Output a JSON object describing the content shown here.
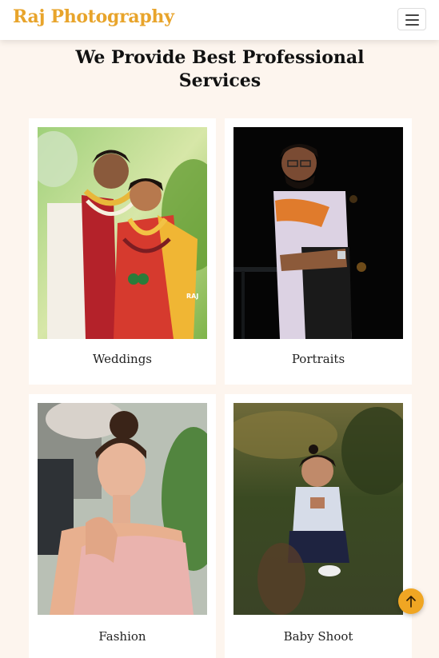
{
  "navbar": {
    "brand": "Raj Photography",
    "toggler_icon": "hamburger-icon",
    "brand_color": "#e8a42b"
  },
  "services": {
    "heading": "We Provide Best Professional Services",
    "items": [
      {
        "label": "Weddings",
        "image": "wedding-couple-photo"
      },
      {
        "label": "Portraits",
        "image": "man-portrait-photo"
      },
      {
        "label": "Fashion",
        "image": "woman-fashion-photo"
      },
      {
        "label": "Baby Shoot",
        "image": "baby-outdoor-photo"
      }
    ]
  },
  "scroll_top": {
    "icon": "arrow-up-icon",
    "color": "#f0a623"
  },
  "colors": {
    "page_background": "#fdf5ee",
    "card_background": "#ffffff",
    "accent": "#e8a42b"
  }
}
